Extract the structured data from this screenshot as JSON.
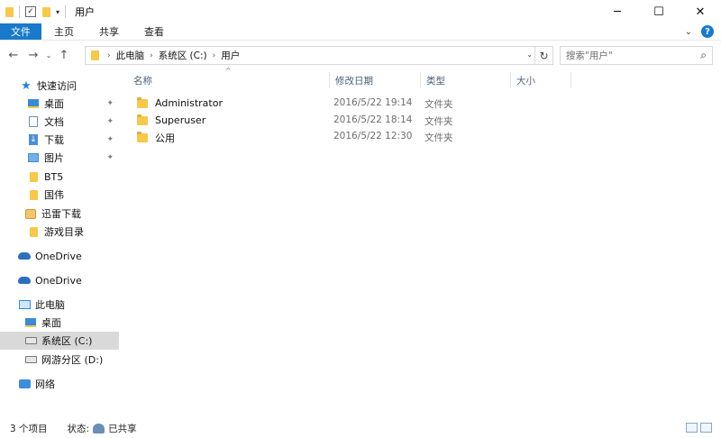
{
  "window": {
    "title": "用户",
    "controls": [
      "─",
      "☐",
      "✕"
    ]
  },
  "ribbon": {
    "tabs": [
      "文件",
      "主页",
      "共享",
      "查看"
    ],
    "expand_glyph": "⌄",
    "help_glyph": "?"
  },
  "nav": {
    "back": "←",
    "forward": "→",
    "recent": "⌄",
    "up": "↑"
  },
  "address": {
    "crumbs": [
      "此电脑",
      "系统区 (C:)",
      "用户"
    ],
    "arrow": "›",
    "refresh": "↻",
    "dropdown": "⌄"
  },
  "search": {
    "placeholder": "搜索\"用户\"",
    "icon_glyph": "⌕"
  },
  "sidebar": {
    "items": [
      {
        "label": "快速访问",
        "icon": "star-icon",
        "pinned": false
      },
      {
        "label": "桌面",
        "icon": "desktop-icon",
        "pinned": true
      },
      {
        "label": "文档",
        "icon": "document-icon",
        "pinned": true
      },
      {
        "label": "下载",
        "icon": "download-icon",
        "pinned": true
      },
      {
        "label": "图片",
        "icon": "pictures-icon",
        "pinned": true
      },
      {
        "label": "BT5",
        "icon": "folder-icon",
        "pinned": false
      },
      {
        "label": "国伟",
        "icon": "folder-icon",
        "pinned": false
      },
      {
        "label": "迅雷下载",
        "icon": "thunder-folder-icon",
        "pinned": false
      },
      {
        "label": "游戏目录",
        "icon": "folder-icon",
        "pinned": false
      },
      {
        "label": "OneDrive",
        "icon": "cloud-icon",
        "pinned": false
      },
      {
        "label": "OneDrive",
        "icon": "cloud-icon",
        "pinned": false
      },
      {
        "label": "此电脑",
        "icon": "computer-icon",
        "pinned": false
      },
      {
        "label": "桌面",
        "icon": "desktop-icon",
        "pinned": false
      },
      {
        "label": "系统区 (C:)",
        "icon": "drive-icon",
        "pinned": false,
        "selected": true
      },
      {
        "label": "网游分区 (D:)",
        "icon": "drive-icon",
        "pinned": false
      },
      {
        "label": "网络",
        "icon": "network-icon",
        "pinned": false
      }
    ],
    "pin_glyph": "📌"
  },
  "columns": [
    "名称",
    "修改日期",
    "类型",
    "大小"
  ],
  "sort_glyph": "^",
  "files": [
    {
      "name": "Administrator",
      "date": "2016/5/22 19:14",
      "type": "文件夹"
    },
    {
      "name": "Superuser",
      "date": "2016/5/22 18:14",
      "type": "文件夹"
    },
    {
      "name": "公用",
      "date": "2016/5/22 12:30",
      "type": "文件夹"
    }
  ],
  "status": {
    "count": "3 个项目",
    "state_label": "状态:",
    "state_value": "已共享"
  }
}
